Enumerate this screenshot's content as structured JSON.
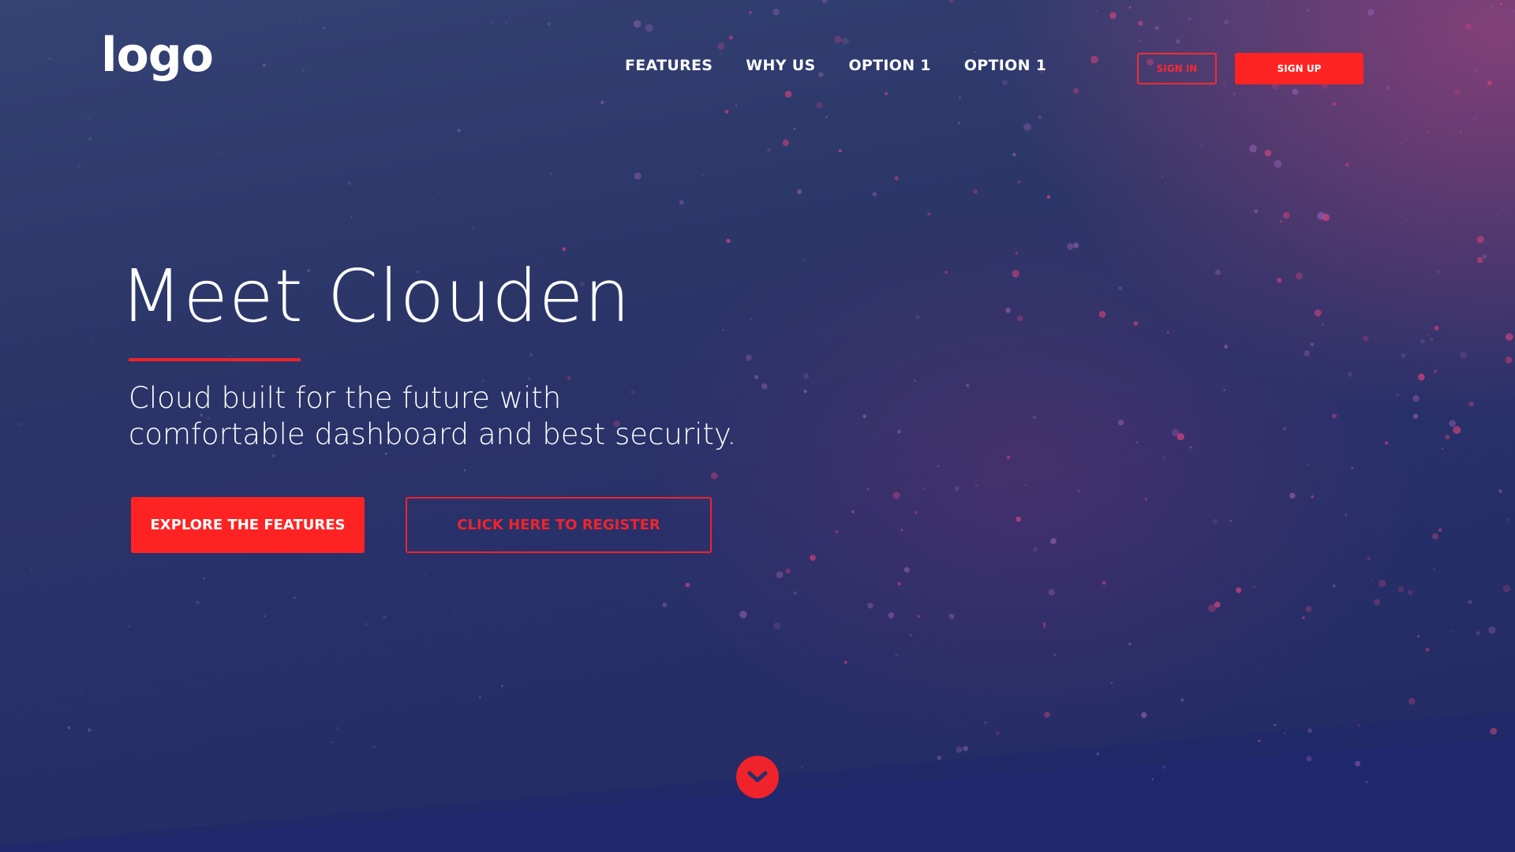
{
  "header": {
    "logo_text": "logo",
    "nav": [
      {
        "label": "FEATURES"
      },
      {
        "label": "WHY US"
      },
      {
        "label": "OPTION 1"
      },
      {
        "label": "OPTION 1"
      }
    ],
    "signin_label": "SIGN IN",
    "signup_label": "SIGN UP"
  },
  "hero": {
    "title": "Meet Clouden",
    "subtitle_line1": "Cloud built for the future with",
    "subtitle_line2": "comfortable dashboard and best security.",
    "primary_cta": "EXPLORE THE FEATURES",
    "secondary_cta": "CLICK HERE TO REGISTER"
  },
  "scroll": {
    "icon": "chevron-down-icon"
  },
  "colors": {
    "accent": "#fe2323",
    "accent_outline": "#f0232b",
    "background_dark": "#222a63",
    "background_light": "#344274",
    "glow": "#c84682",
    "text": "#ffffff"
  }
}
